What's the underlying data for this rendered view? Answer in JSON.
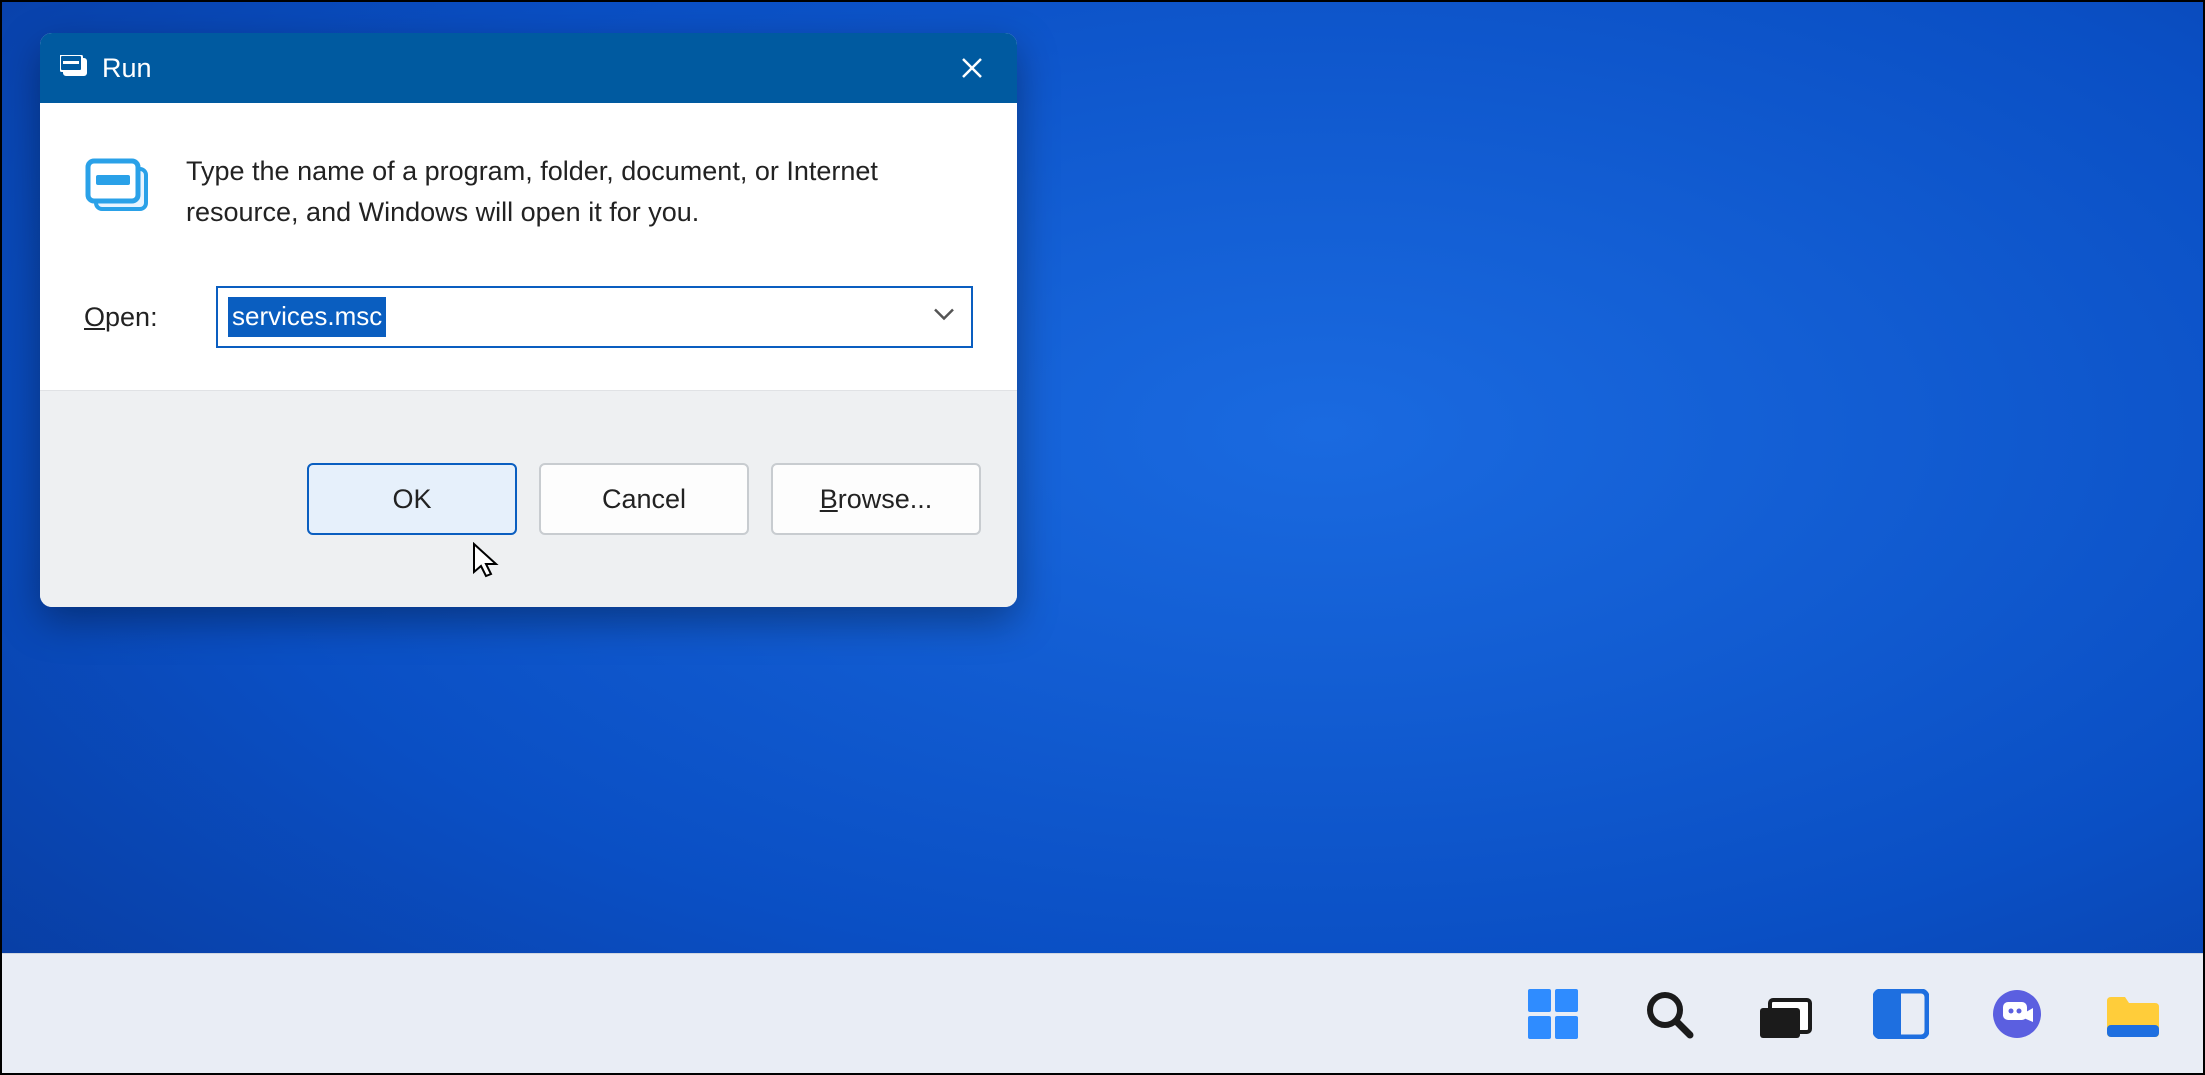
{
  "dialog": {
    "title": "Run",
    "instruction": "Type the name of a program, folder, document, or Internet resource, and Windows will open it for you.",
    "open_label_underline": "O",
    "open_label_rest": "pen:",
    "command_value": "services.msc",
    "buttons": {
      "ok": "OK",
      "cancel": "Cancel",
      "browse_underline": "B",
      "browse_rest": "rowse..."
    }
  },
  "taskbar": {
    "items": [
      "start",
      "search",
      "task-view",
      "widgets",
      "chat",
      "file-explorer"
    ]
  }
}
